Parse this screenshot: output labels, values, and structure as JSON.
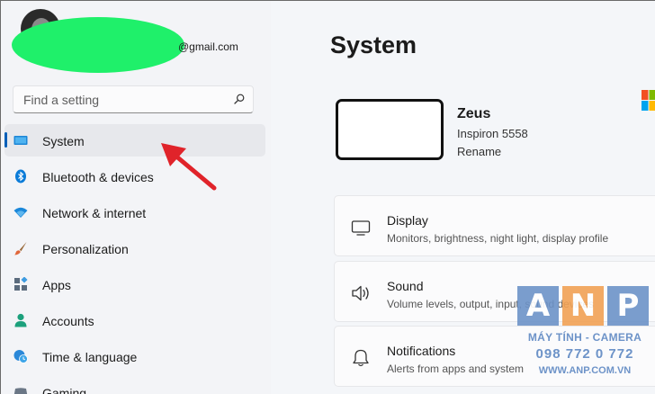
{
  "account": {
    "email": "@gmail.com"
  },
  "search": {
    "placeholder": "Find a setting"
  },
  "sidebar": {
    "items": [
      {
        "label": "System",
        "icon": "system-icon",
        "active": true
      },
      {
        "label": "Bluetooth & devices",
        "icon": "bluetooth-icon"
      },
      {
        "label": "Network & internet",
        "icon": "wifi-icon"
      },
      {
        "label": "Personalization",
        "icon": "brush-icon"
      },
      {
        "label": "Apps",
        "icon": "apps-icon"
      },
      {
        "label": "Accounts",
        "icon": "person-icon"
      },
      {
        "label": "Time & language",
        "icon": "globe-clock-icon"
      },
      {
        "label": "Gaming",
        "icon": "gaming-icon"
      }
    ]
  },
  "main": {
    "title": "System",
    "device": {
      "name": "Zeus",
      "model": "Inspiron 5558",
      "rename_label": "Rename"
    },
    "cards": [
      {
        "title": "Display",
        "subtitle": "Monitors, brightness, night light, display profile",
        "icon": "display-icon"
      },
      {
        "title": "Sound",
        "subtitle": "Volume levels, output, input, sound devices",
        "icon": "speaker-icon"
      },
      {
        "title": "Notifications",
        "subtitle": "Alerts from apps and system",
        "icon": "bell-icon"
      }
    ]
  },
  "watermark": {
    "letters": [
      "A",
      "N",
      "P"
    ],
    "line1": "MÁY TÍNH - CAMERA",
    "line2": "098 772 0 772",
    "line3": "WWW.ANP.COM.VN"
  },
  "colors": {
    "accent": "#005fb8",
    "arrow": "#e0232a",
    "account_blob": "#1ff06a"
  }
}
